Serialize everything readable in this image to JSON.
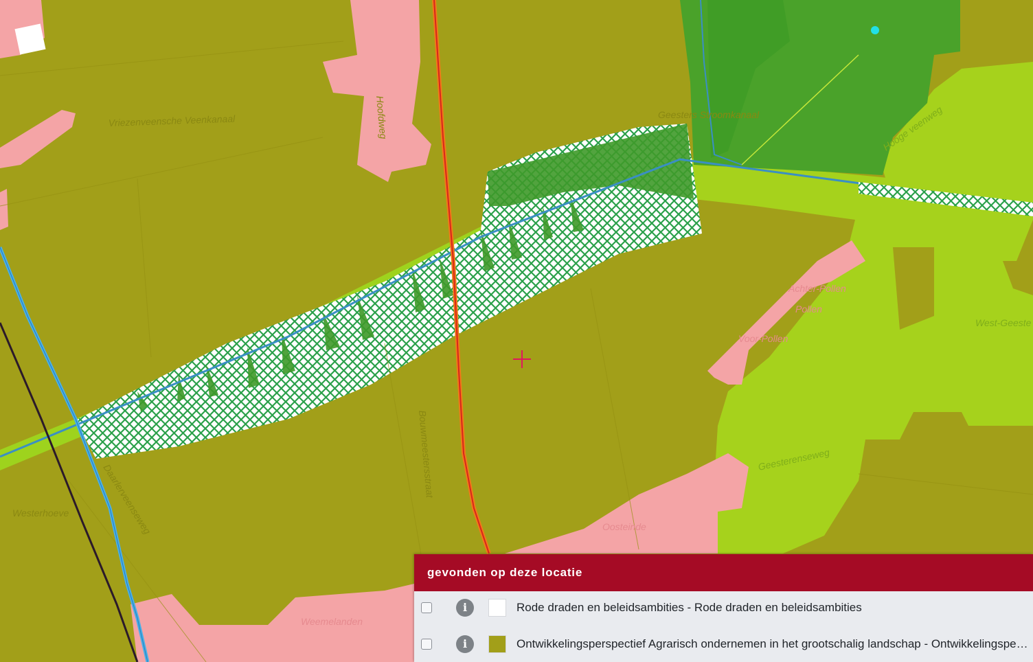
{
  "map": {
    "colors": {
      "agrarisch": "#a29f19",
      "bos": "#4aa22a",
      "natuur_licht": "#a6d21c",
      "bebouwing": "#f4a4a6",
      "hatch": "#2aa04a",
      "weg": "#e8471f",
      "water": "#49b0e8",
      "spoor": "#2b1a2a"
    },
    "labels": [
      {
        "text": "Vriezenveensche Veenkanaal",
        "style": "normal"
      },
      {
        "text": "Hoofdweg",
        "style": "normal"
      },
      {
        "text": "Geesters Stroomkanaal",
        "style": "normal"
      },
      {
        "text": "Achter-Pollen",
        "style": "pink"
      },
      {
        "text": "Pollen",
        "style": "pink"
      },
      {
        "text": "Voor-Pollen",
        "style": "pink"
      },
      {
        "text": "West-Geeste",
        "style": "light"
      },
      {
        "text": "Geesterenseweg",
        "style": "light"
      },
      {
        "text": "Bouwmeestersstraat",
        "style": "normal"
      },
      {
        "text": "Oosteinde",
        "style": "pink"
      },
      {
        "text": "Westerhoeve",
        "style": "normal"
      },
      {
        "text": "Daarlerveenseweg",
        "style": "normal"
      },
      {
        "text": "Weemelanden",
        "style": "pink"
      },
      {
        "text": "Hooge veenweg",
        "style": "light"
      }
    ],
    "marker_icon": "crosshair-icon"
  },
  "results_panel": {
    "title": "gevonden op deze locatie",
    "items": [
      {
        "label": "Rode draden en beleidsambities - Rode draden en beleidsambities",
        "swatch_color": "#ffffff",
        "checked": false,
        "info_icon": "info-icon"
      },
      {
        "label": "Ontwikkelingsperspectief Agrarisch ondernemen in het grootschalig landschap - Ontwikkelingsperspectief Agrarisch ondernemen in het grootschalig landschap",
        "swatch_color": "#a29f19",
        "checked": false,
        "info_icon": "info-icon"
      }
    ]
  }
}
